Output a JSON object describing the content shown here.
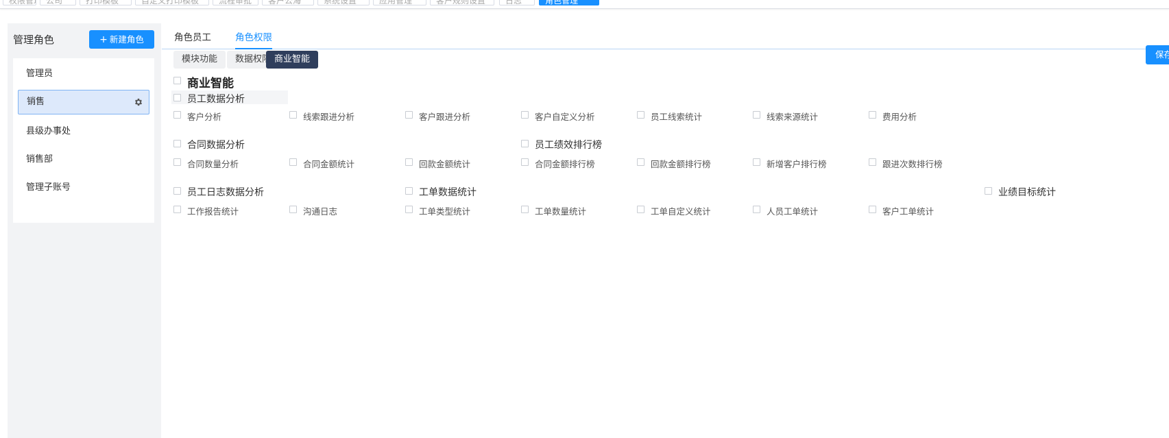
{
  "top_tabs": [
    "权限管理",
    "公司",
    "打印模板",
    "自定义打印模板",
    "流程审批",
    "客户公海",
    "系统设置",
    "应用管理",
    "客户规则设置",
    "日志",
    "角色管理"
  ],
  "sidebar": {
    "title": "管理角色",
    "new_role_label": "新建角色",
    "roles": [
      "管理员",
      "销售",
      "县级办事处",
      "销售部",
      "管理子账号"
    ],
    "selected": "销售"
  },
  "tabs": {
    "items": [
      "角色员工",
      "角色权限"
    ],
    "active": "角色权限"
  },
  "subtabs": {
    "items": [
      "模块功能",
      "数据权限",
      "商业智能"
    ],
    "active": "商业智能"
  },
  "save_label": "保存",
  "bi": {
    "root": "商业智能",
    "groups": [
      {
        "title": "员工数据分析",
        "items": [
          "客户分析",
          "线索跟进分析",
          "客户跟进分析",
          "客户自定义分析",
          "员工线索统计",
          "线索来源统计",
          "费用分析"
        ]
      },
      {
        "title": "合同数据分析",
        "items": [
          "合同数量分析",
          "合同金额统计",
          "回款金额统计"
        ]
      },
      {
        "title": "员工绩效排行榜",
        "items": [
          "合同金额排行榜",
          "回款金额排行榜",
          "新增客户排行榜",
          "跟进次数排行榜"
        ]
      },
      {
        "title": "员工日志数据分析",
        "items": [
          "工作报告统计",
          "沟通日志"
        ]
      },
      {
        "title": "工单数据统计",
        "items": [
          "工单类型统计",
          "工单数量统计",
          "工单自定义统计",
          "人员工单统计",
          "客户工单统计"
        ]
      },
      {
        "title": "业绩目标统计",
        "items": []
      }
    ]
  }
}
